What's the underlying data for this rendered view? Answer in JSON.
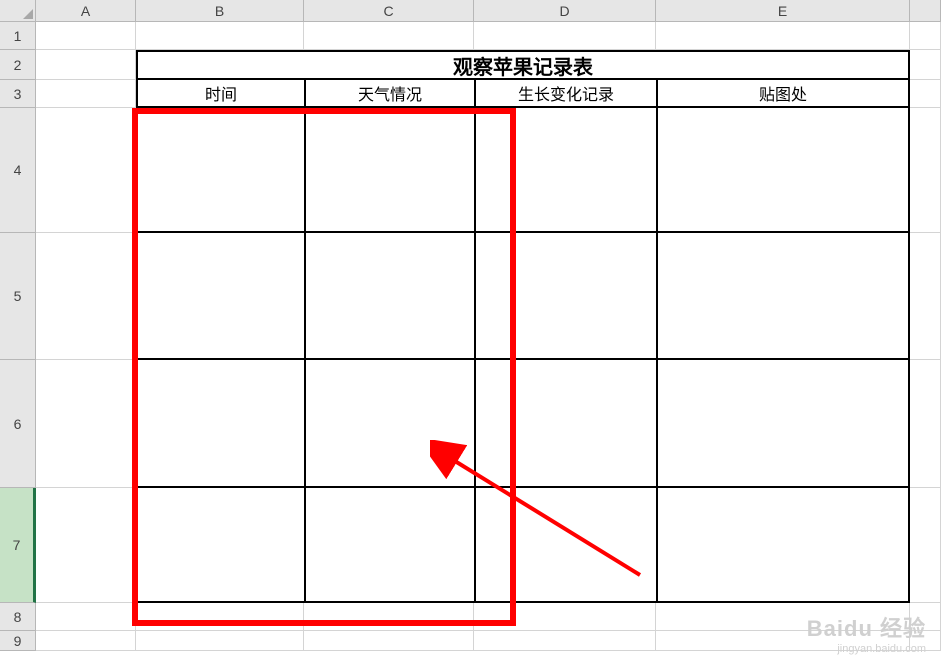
{
  "columns": [
    "A",
    "B",
    "C",
    "D",
    "E"
  ],
  "rows": [
    "1",
    "2",
    "3",
    "4",
    "5",
    "6",
    "7",
    "8",
    "9"
  ],
  "selectedRow": "7",
  "table": {
    "title": "观察苹果记录表",
    "headers": {
      "b": "时间",
      "c": "天气情况",
      "d": "生长变化记录",
      "e": "贴图处"
    }
  },
  "annotation": {
    "color": "#ff0000"
  },
  "watermark": {
    "logo": "Baidu 经验",
    "url": "jingyan.baidu.com"
  }
}
